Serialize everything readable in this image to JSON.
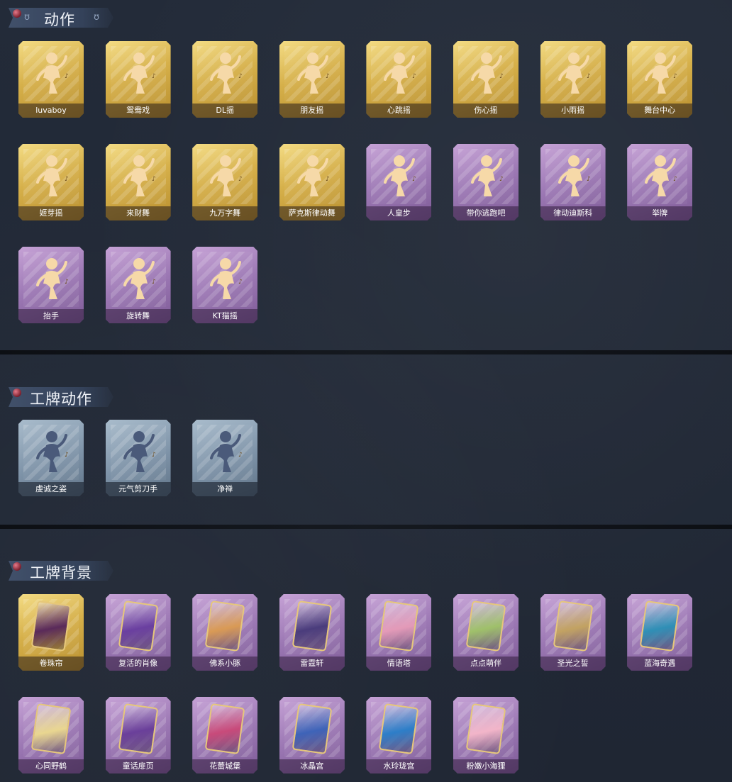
{
  "sections": [
    {
      "title": "动作"
    },
    {
      "title": "工牌动作"
    },
    {
      "title": "工牌背景"
    }
  ],
  "actions": [
    {
      "label": "luvaboy",
      "rarity": "gold"
    },
    {
      "label": "鸳鸯戏",
      "rarity": "gold"
    },
    {
      "label": "DL摇",
      "rarity": "gold"
    },
    {
      "label": "朋友摇",
      "rarity": "gold"
    },
    {
      "label": "心跳摇",
      "rarity": "gold"
    },
    {
      "label": "伤心摇",
      "rarity": "gold"
    },
    {
      "label": "小雨摇",
      "rarity": "gold"
    },
    {
      "label": "舞台中心",
      "rarity": "gold"
    },
    {
      "label": "姬芽摇",
      "rarity": "gold"
    },
    {
      "label": "来财舞",
      "rarity": "gold"
    },
    {
      "label": "九万字舞",
      "rarity": "gold"
    },
    {
      "label": "萨克斯律动舞",
      "rarity": "gold"
    },
    {
      "label": "人皇步",
      "rarity": "purple"
    },
    {
      "label": "带你逃跑吧",
      "rarity": "purple"
    },
    {
      "label": "律动迪斯科",
      "rarity": "purple"
    },
    {
      "label": "举牌",
      "rarity": "purple"
    },
    {
      "label": "抬手",
      "rarity": "purple"
    },
    {
      "label": "旋转舞",
      "rarity": "purple"
    },
    {
      "label": "KT猫摇",
      "rarity": "purple"
    }
  ],
  "badge_actions": [
    {
      "label": "虔诚之姿",
      "rarity": "blue"
    },
    {
      "label": "元气剪刀手",
      "rarity": "blue"
    },
    {
      "label": "净禅",
      "rarity": "blue"
    }
  ],
  "badge_backgrounds": [
    {
      "label": "卷珠帘",
      "rarity": "gold",
      "color": "#5a2a5a"
    },
    {
      "label": "复活的肖像",
      "rarity": "purple",
      "color": "#6a3fa0"
    },
    {
      "label": "佛系小豚",
      "rarity": "purple",
      "color": "#d99a55"
    },
    {
      "label": "雷霆轩",
      "rarity": "purple",
      "color": "#4a3c7c"
    },
    {
      "label": "情语塔",
      "rarity": "purple",
      "color": "#e39ab8"
    },
    {
      "label": "点点萌伴",
      "rarity": "purple",
      "color": "#9fc06a"
    },
    {
      "label": "圣光之誓",
      "rarity": "purple",
      "color": "#c2a262"
    },
    {
      "label": "蓝海奇遇",
      "rarity": "purple",
      "color": "#2f8fb6"
    },
    {
      "label": "心同野鹤",
      "rarity": "purple",
      "color": "#e9d690"
    },
    {
      "label": "童话扉页",
      "rarity": "purple",
      "color": "#6a3f9a"
    },
    {
      "label": "花蕾城堡",
      "rarity": "purple",
      "color": "#c84a7a"
    },
    {
      "label": "冰晶宫",
      "rarity": "purple",
      "color": "#3e63b8"
    },
    {
      "label": "水玲珑宫",
      "rarity": "purple",
      "color": "#2d7ec8"
    },
    {
      "label": "粉嫩小海狸",
      "rarity": "purple",
      "color": "#f2b5c9"
    }
  ]
}
